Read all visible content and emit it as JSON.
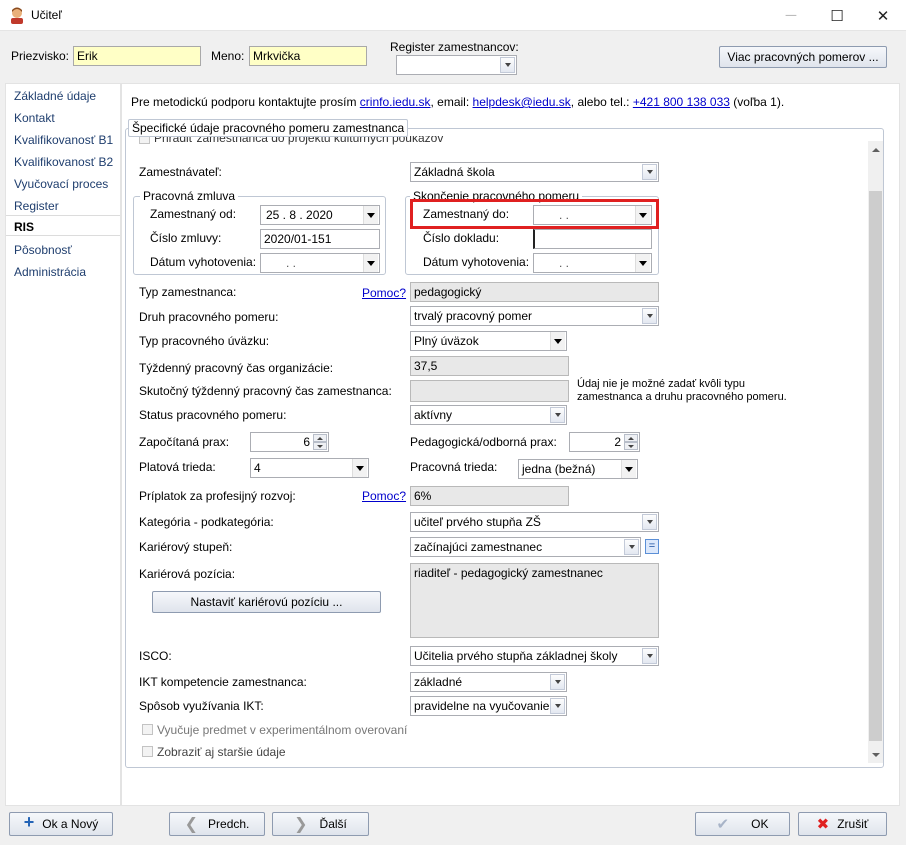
{
  "window": {
    "title": "Učiteľ",
    "minimize_icon": "─",
    "maximize_icon": "☐",
    "close_icon": "✕"
  },
  "header": {
    "surname_label": "Priezvisko:",
    "surname_value": "Erik",
    "name_label": "Meno:",
    "name_value": "Mrkvička",
    "register_label": "Register zamestnancov:",
    "register_value": "",
    "more_button": "Viac pracovných pomerov ..."
  },
  "sidebar": {
    "items": [
      {
        "label": "Základné údaje"
      },
      {
        "label": "Kontakt"
      },
      {
        "label": "Kvalifikovanosť B1"
      },
      {
        "label": "Kvalifikovanosť B2"
      },
      {
        "label": "Vyučovací proces"
      },
      {
        "label": "Register"
      },
      {
        "label": "RIS"
      },
      {
        "label": "Pôsobnosť"
      },
      {
        "label": "Administrácia"
      }
    ],
    "active": "RIS"
  },
  "support": {
    "text1": "Pre metodickú podporu kontaktujte prosím",
    "link1": "crinfo.iedu.sk",
    "text2": ", email:",
    "link2": "helpdesk@iedu.sk",
    "text3": ", alebo tel.:",
    "link3": "+421 800 138 033",
    "text4": "(voľba 1)."
  },
  "group": {
    "title": "Špecifické údaje pracovného pomeru zamestnanca",
    "partial_row": "Priradiť zamestnanca do projektu kultúrnych poukazov"
  },
  "form": {
    "employer_label": "Zamestnávateľ:",
    "employer_value": "Základná škola",
    "contract_group": "Pracovná zmluva",
    "employed_from_label": "Zamestnaný od:",
    "employed_from_value": "25 .   8 . 2020",
    "contract_no_label": "Číslo zmluvy:",
    "contract_no_value": "2020/01-151",
    "issue_date_label": "Dátum vyhotovenia:",
    "issue_date_value": ".     .",
    "end_group": "Skončenie pracovného pomeru",
    "employed_to_label": "Zamestnaný do:",
    "employed_to_value": ".     .",
    "doc_no_label": "Číslo dokladu:",
    "doc_no_value": "",
    "end_issue_label": "Dátum vyhotovenia:",
    "end_issue_value": ".     .",
    "type_label": "Typ zamestnanca:",
    "help1": "Pomoc?",
    "type_value": "pedagogický",
    "kind_label": "Druh pracovného pomeru:",
    "kind_value": "trvalý pracovný pomer",
    "load_label": "Typ pracovného úväzku:",
    "load_value": "Plný úväzok",
    "weekly_org_label": "Týždenný pracovný čas organizácie:",
    "weekly_org_value": "37,5",
    "weekly_emp_label": "Skutočný týždenný pracovný čas zamestnanca:",
    "weekly_emp_value": "",
    "weekly_hint": "Údaj nie je možné zadať kvôli typu zamestnanca a druhu pracovného pomeru.",
    "status_label": "Status pracovného pomeru:",
    "status_value": "aktívny",
    "practice_label": "Započítaná prax:",
    "practice_value": "6",
    "ped_practice_label": "Pedagogická/odborná prax:",
    "ped_practice_value": "2",
    "salary_class_label": "Platová trieda:",
    "salary_class_value": "4",
    "work_class_label": "Pracovná trieda:",
    "work_class_value": "jedna (bežná)",
    "bonus_label": "Príplatok za profesijný rozvoj:",
    "help2": "Pomoc?",
    "bonus_value": "6%",
    "category_label": "Kategória - podkategória:",
    "category_value": "učiteľ prvého stupňa ZŠ",
    "career_level_label": "Kariérový stupeň:",
    "career_level_value": "začínajúci zamestnanec",
    "equals_btn": "=",
    "career_pos_label": "Kariérová pozícia:",
    "career_pos_value": "riaditeľ - pedagogický zamestnanec",
    "set_career_button": "Nastaviť kariérovú pozíciu ...",
    "isco_label": "ISCO:",
    "isco_value": "Učitelia prvého stupňa základnej školy",
    "ikt_label": "IKT kompetencie zamestnanca:",
    "ikt_value": "základné",
    "ikt_use_label": "Spôsob využívania IKT:",
    "ikt_use_value": "pravidelne na vyučovanie",
    "experimental_label": "Vyučuje predmet v experimentálnom overovaní",
    "older_label": "Zobraziť aj staršie údaje"
  },
  "footer": {
    "new_button": "Ok a Nový",
    "prev_button": "Predch.",
    "next_button": "Ďalší",
    "ok_button": "OK",
    "cancel_button": "Zrušiť"
  },
  "colors": {
    "highlight_red": "#e02020",
    "yellow_field": "#ffffc6",
    "link_blue": "#0000cc"
  }
}
